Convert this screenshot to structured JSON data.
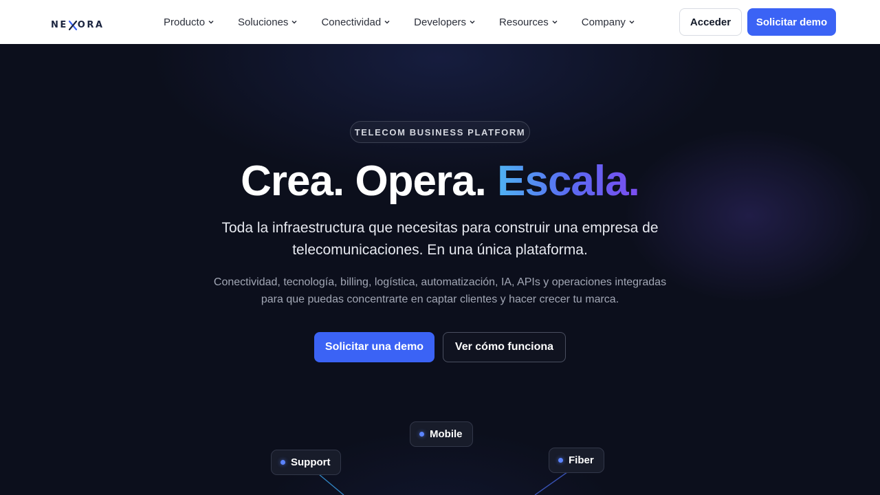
{
  "brand": {
    "logo_text_left": "NE",
    "logo_text_right": "ORA",
    "logo_icon": "x-mark-icon",
    "accent_color": "#3b63f5"
  },
  "nav": {
    "items": [
      {
        "label": "Producto"
      },
      {
        "label": "Soluciones"
      },
      {
        "label": "Conectividad"
      },
      {
        "label": "Developers"
      },
      {
        "label": "Resources"
      },
      {
        "label": "Company"
      }
    ],
    "login_label": "Acceder",
    "demo_label": "Solicitar demo"
  },
  "hero": {
    "badge": "TELECOM BUSINESS PLATFORM",
    "headline_plain": "Crea. Opera.",
    "headline_accent": "Escala.",
    "subtitle": "Toda la infraestructura que necesitas para construir una empresa de telecomunicaciones. En una única plataforma.",
    "description": "Conectividad, tecnología, billing, logística, automatización, IA, APIs y operaciones integradas para que puedas concentrarte en captar clientes y hacer crecer tu marca.",
    "primary_cta": "Solicitar una demo",
    "secondary_cta": "Ver cómo funciona"
  },
  "diagram": {
    "nodes": [
      {
        "label": "Mobile"
      },
      {
        "label": "Support"
      },
      {
        "label": "Fiber"
      }
    ]
  }
}
